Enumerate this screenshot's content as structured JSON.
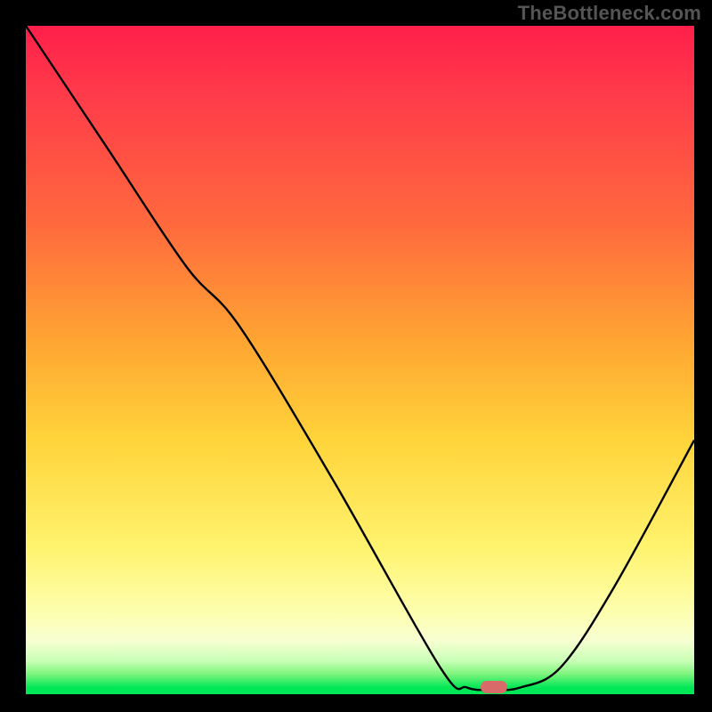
{
  "watermark": "TheBottleneck.com",
  "chart_data": {
    "type": "line",
    "title": "",
    "xlabel": "",
    "ylabel": "",
    "xlim": [
      0,
      100
    ],
    "ylim": [
      0,
      100
    ],
    "series": [
      {
        "name": "bottleneck-curve",
        "x": [
          0,
          12,
          24,
          32,
          46,
          62,
          66,
          70,
          74,
          80,
          88,
          100
        ],
        "values": [
          100,
          82,
          64,
          55,
          32,
          4,
          1,
          0.7,
          1,
          4,
          16,
          38
        ]
      }
    ],
    "marker": {
      "x": 70,
      "y": 0.7
    },
    "gradient_note": "vertical heat gradient, red=high bottleneck, green=optimal"
  },
  "colors": {
    "curve": "#000000",
    "marker": "#d96a6a",
    "background_frame": "#000000"
  }
}
